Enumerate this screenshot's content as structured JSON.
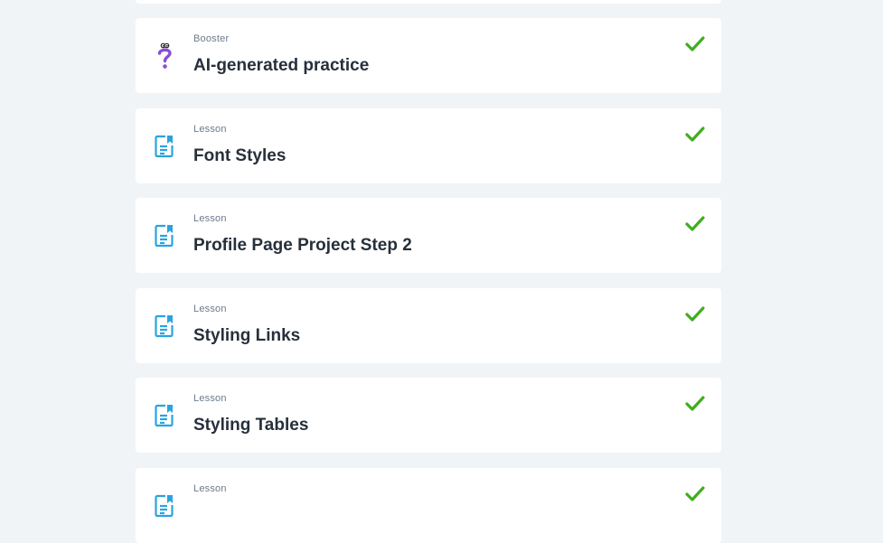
{
  "items": [
    {
      "type": "Booster",
      "title": "AI-generated practice",
      "icon": "booster-question-icon",
      "completed": true
    },
    {
      "type": "Lesson",
      "title": "Font Styles",
      "icon": "lesson-document-icon",
      "completed": true
    },
    {
      "type": "Lesson",
      "title": "Profile Page Project Step 2",
      "icon": "lesson-document-icon",
      "completed": true
    },
    {
      "type": "Lesson",
      "title": "Styling Links",
      "icon": "lesson-document-icon",
      "completed": true
    },
    {
      "type": "Lesson",
      "title": "Styling Tables",
      "icon": "lesson-document-icon",
      "completed": true
    },
    {
      "type": "Lesson",
      "title": "",
      "icon": "lesson-document-icon",
      "completed": true
    }
  ],
  "colors": {
    "background": "#f1f4f7",
    "card": "#ffffff",
    "check": "#3fae1f",
    "lesson_icon": "#2aa3e0",
    "booster_icon": "#8a4fd8",
    "title": "#26303b",
    "type_label": "#6b7a8b"
  }
}
